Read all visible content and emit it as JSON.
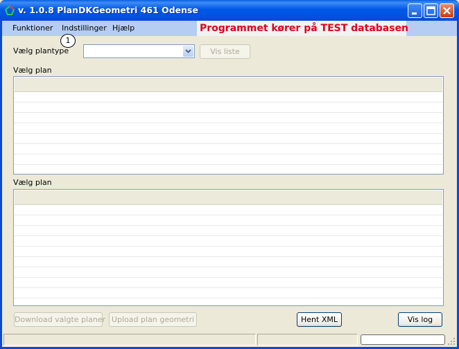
{
  "window": {
    "title": "v. 1.0.8  PlanDKGeometri   461 Odense"
  },
  "menu": {
    "items": [
      "Funktioner",
      "Indstillinger",
      "Hjælp"
    ],
    "banner": "Programmet kører på TEST databasen",
    "marker": "1"
  },
  "form": {
    "plantype_label": "Vælg plantype",
    "plantype_value": "",
    "vis_liste_label": "Vis liste",
    "list1_label": "Vælg plan",
    "list2_label": "Vælg plan"
  },
  "buttons": {
    "download": "Download valgte planer",
    "upload": "Upload plan geometri",
    "hent_xml": "Hent XML",
    "vis_log": "Vis log"
  },
  "colors": {
    "banner_text": "#e0001b",
    "titlebar": "#0054e3",
    "menubar": "#b5cdf3"
  }
}
